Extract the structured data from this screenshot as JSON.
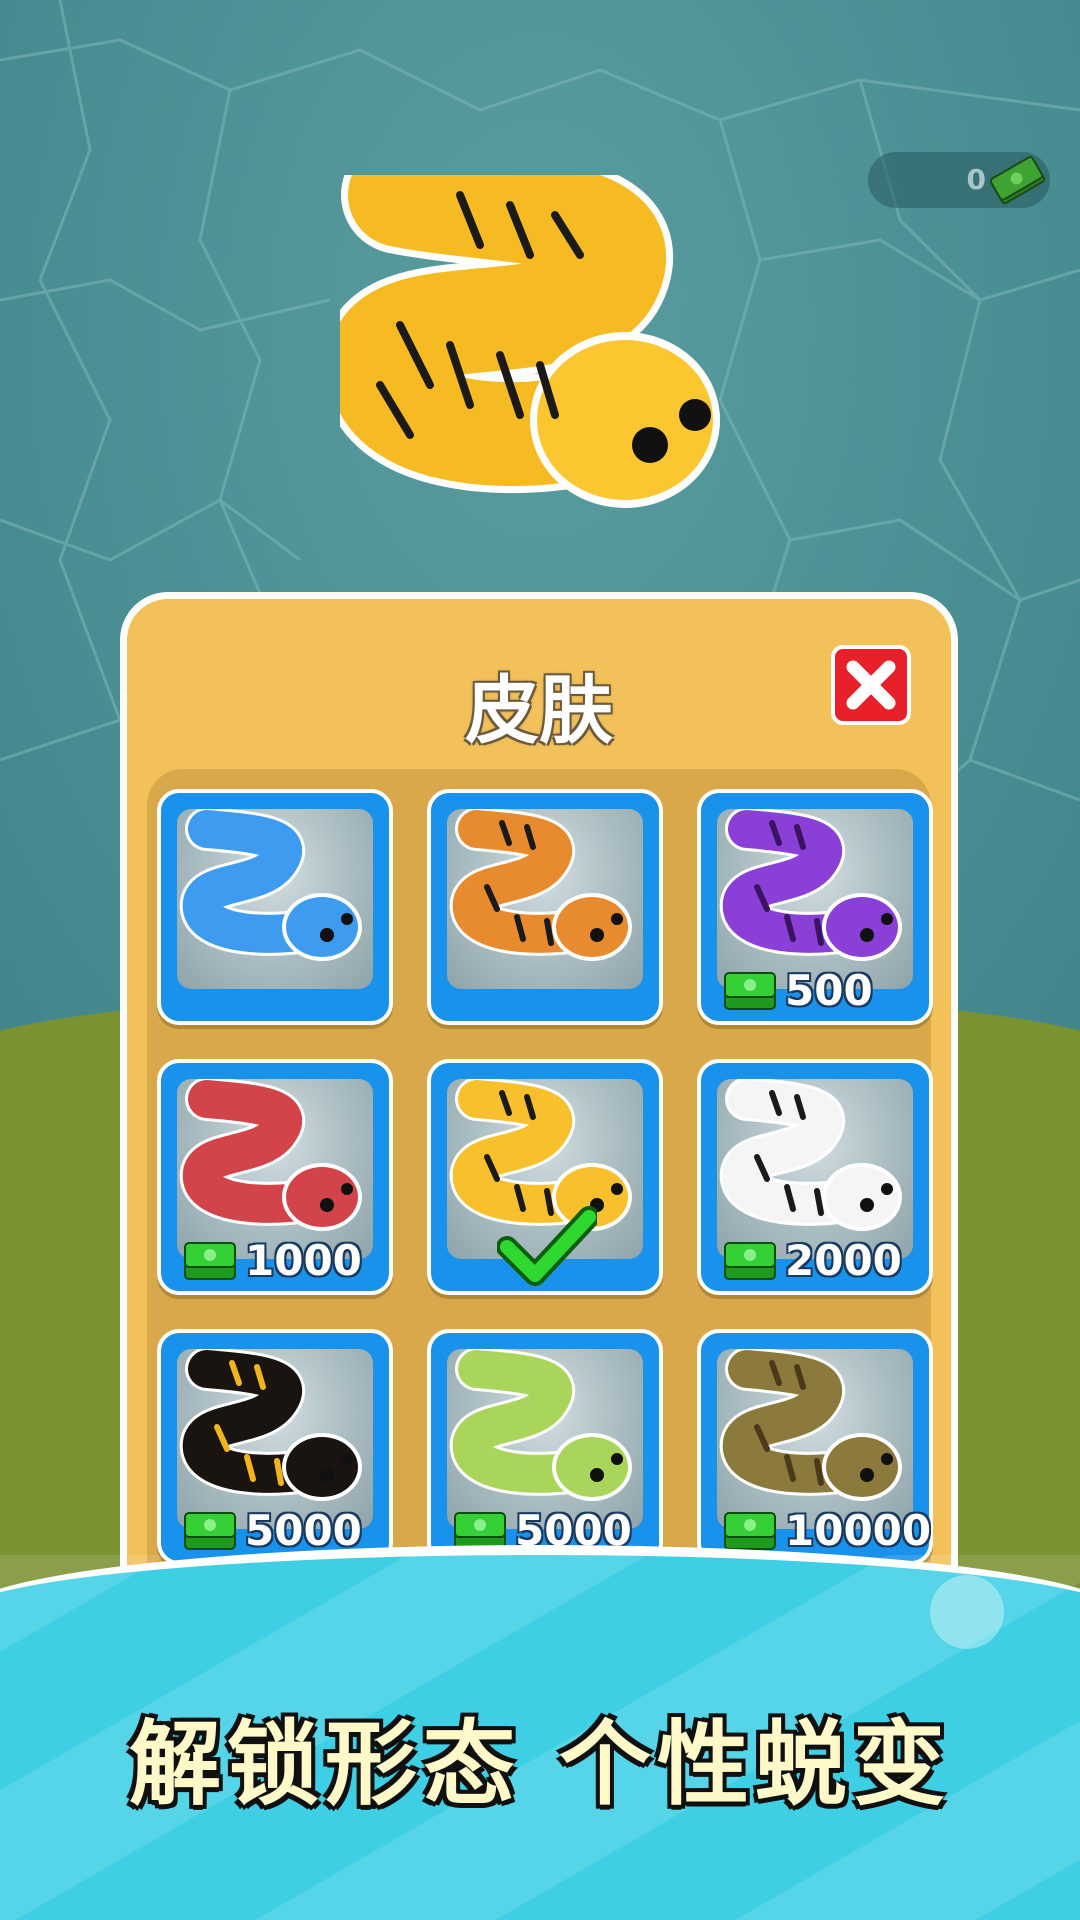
{
  "hud": {
    "currency_value": "0",
    "currency_icon": "cash-icon"
  },
  "skin_panel": {
    "title": "皮肤",
    "close_icon": "close-icon",
    "skins": [
      {
        "name": "blue",
        "color": "#3d9bf0",
        "price": "",
        "state": "owned"
      },
      {
        "name": "orange-tiger",
        "color": "#e88a2e",
        "price": "",
        "state": "owned"
      },
      {
        "name": "purple-spotted",
        "color": "#8a3fd6",
        "price": "500",
        "state": "locked"
      },
      {
        "name": "red",
        "color": "#d2444a",
        "price": "1000",
        "state": "locked"
      },
      {
        "name": "yellow-tiger",
        "color": "#f7c02c",
        "price": "",
        "state": "selected"
      },
      {
        "name": "white-zebra",
        "color": "#f5f5f5",
        "price": "2000",
        "state": "locked"
      },
      {
        "name": "black-yellow-banded",
        "color": "#1a1410",
        "price": "5000",
        "state": "locked"
      },
      {
        "name": "lime-green",
        "color": "#a9d65a",
        "price": "5000",
        "state": "locked"
      },
      {
        "name": "olive-python",
        "color": "#8c7a3c",
        "price": "10000",
        "state": "locked"
      }
    ]
  },
  "banner": {
    "slogan": "解锁形态  个性蜕变"
  }
}
